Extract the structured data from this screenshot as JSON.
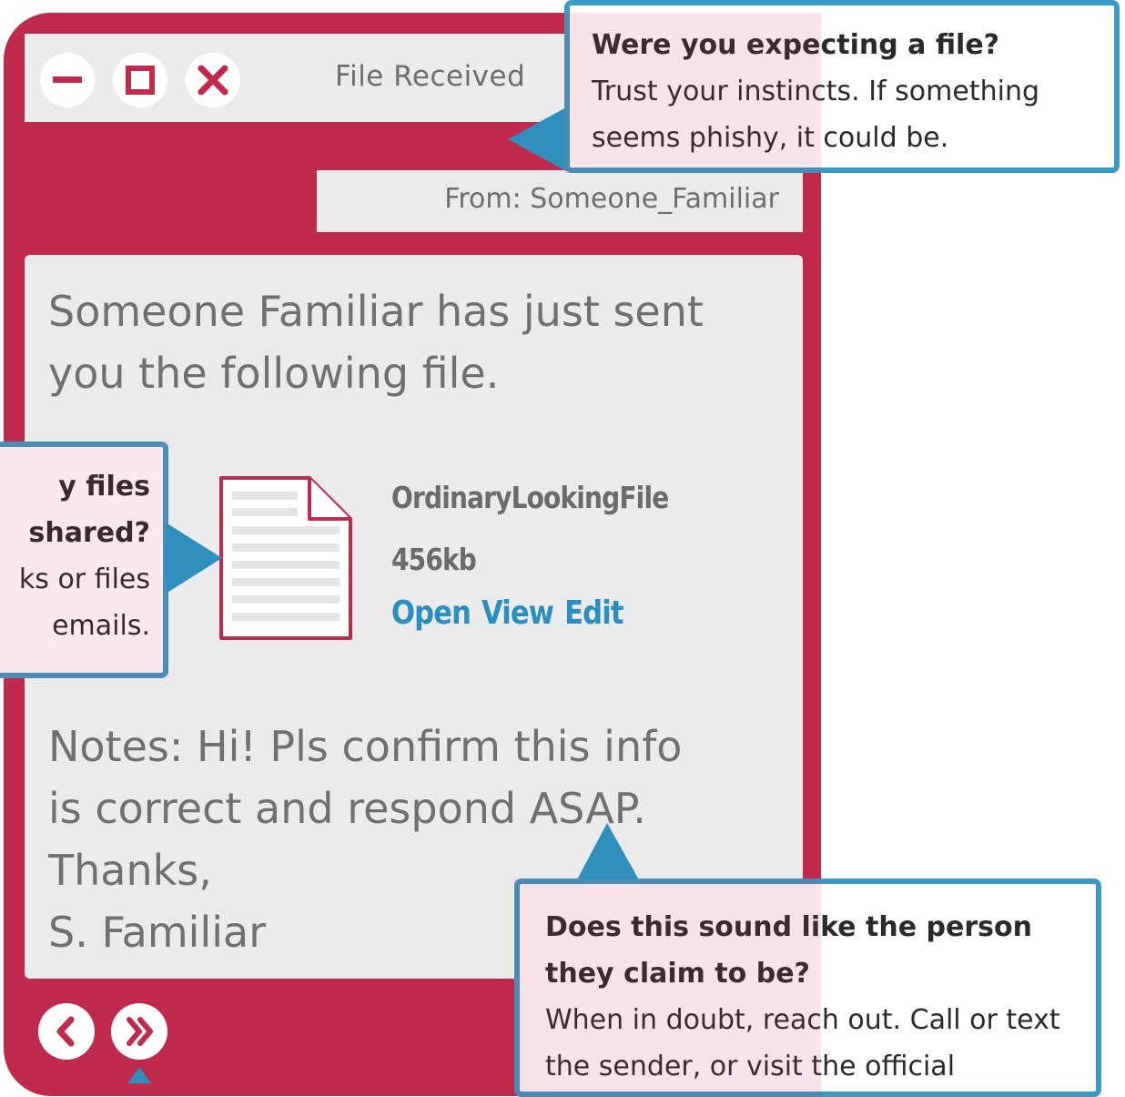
{
  "window": {
    "title": "File Received",
    "from": "From: Someone_Familiar",
    "message": "Someone Familiar has just sent you the following file.",
    "file": {
      "name": "OrdinaryLookingFile",
      "size": "456kb",
      "actions": [
        "Open",
        "View",
        "Edit"
      ]
    },
    "notes": [
      "Notes: Hi! Pls confirm this info",
      "is correct and respond ASAP.",
      "Thanks,",
      "S. Familiar"
    ]
  },
  "callouts": {
    "expecting": {
      "heading": "Were you expecting a file?",
      "body": "Trust your instincts. If something seems phishy, it could be."
    },
    "files_shared": {
      "lines": [
        "y files",
        "shared?",
        "ks or files",
        "emails."
      ]
    },
    "sound_like": {
      "heading": "Does this sound like the person they claim to be?",
      "body": "When in doubt, reach out. Call or text the sender, or visit the official"
    }
  },
  "colors": {
    "window_bg": "#c02a4c",
    "panel_bg": "#ebebeb",
    "callout_border": "#3a9ac4",
    "action_link": "#2a8fc0"
  },
  "icons": [
    "minimize-icon",
    "maximize-icon",
    "close-icon",
    "document-icon",
    "chevron-left-icon",
    "double-chevron-right-icon"
  ]
}
